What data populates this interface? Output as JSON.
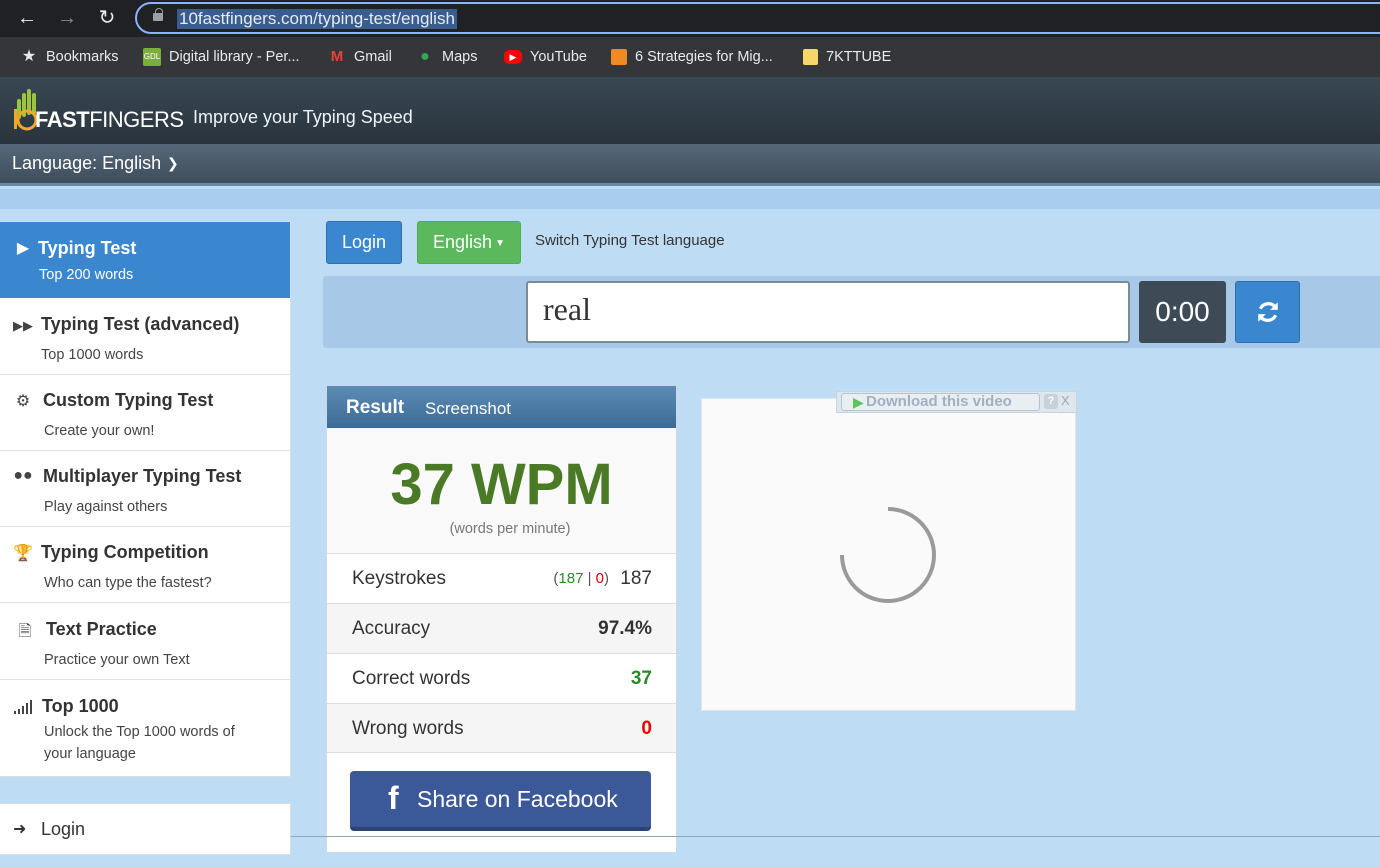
{
  "browser": {
    "url": "10fastfingers.com/typing-test/english",
    "bookmarks": [
      {
        "label": "Bookmarks",
        "icon": "star-icon"
      },
      {
        "label": "Digital library - Per...",
        "icon": "gdl-icon"
      },
      {
        "label": "Gmail",
        "icon": "gmail-icon"
      },
      {
        "label": "Maps",
        "icon": "maps-icon"
      },
      {
        "label": "YouTube",
        "icon": "youtube-icon"
      },
      {
        "label": "6 Strategies for Mig...",
        "icon": "cube-icon"
      },
      {
        "label": "7KTTUBE",
        "icon": "folder-icon"
      }
    ]
  },
  "site": {
    "logo_strong": "FAST",
    "logo_light": "FINGERS",
    "logo_number": "10",
    "tagline": "Improve your Typing Speed",
    "language_label": "Language: English"
  },
  "sidebar": {
    "items": [
      {
        "title": "Typing Test",
        "subtitle": "Top 200 words",
        "icon": "play-icon",
        "active": true
      },
      {
        "title": "Typing Test (advanced)",
        "subtitle": "Top 1000 words",
        "icon": "fast-forward-icon"
      },
      {
        "title": "Custom Typing Test",
        "subtitle": "Create your own!",
        "icon": "gears-icon"
      },
      {
        "title": "Multiplayer Typing Test",
        "subtitle": "Play against others",
        "icon": "users-icon"
      },
      {
        "title": "Typing Competition",
        "subtitle": "Who can type the fastest?",
        "icon": "trophy-icon"
      },
      {
        "title": "Text Practice",
        "subtitle": "Practice your own Text",
        "icon": "document-icon"
      },
      {
        "title": "Top 1000",
        "subtitle": "Unlock the Top 1000 words of your language",
        "icon": "signal-bars-icon"
      }
    ],
    "login_label": "Login"
  },
  "toolbar": {
    "login_label": "Login",
    "language_button": "English",
    "switch_label": "Switch Typing Test language"
  },
  "typing": {
    "input_value": "real",
    "timer": "0:00"
  },
  "result": {
    "title": "Result",
    "screenshot_label": "Screenshot",
    "wpm": "37 WPM",
    "wpm_sub": "(words per minute)",
    "keystrokes_label": "Keystrokes",
    "keystrokes_open": "(",
    "keystrokes_correct": "187",
    "keystrokes_sep": " | ",
    "keystrokes_wrong": "0",
    "keystrokes_close": ")",
    "keystrokes_total": "187",
    "accuracy_label": "Accuracy",
    "accuracy_value": "97.4%",
    "correct_label": "Correct words",
    "correct_value": "37",
    "wrong_label": "Wrong words",
    "wrong_value": "0",
    "share_label": "Share on Facebook"
  },
  "video": {
    "download_label": "Download this video",
    "help_label": "?",
    "close_label": "X"
  },
  "colors": {
    "primary_blue": "#3b87cf",
    "green": "#5cb85c",
    "wpm_green": "#4a7a26",
    "facebook": "#3b5998",
    "background": "#bfdcf5"
  }
}
